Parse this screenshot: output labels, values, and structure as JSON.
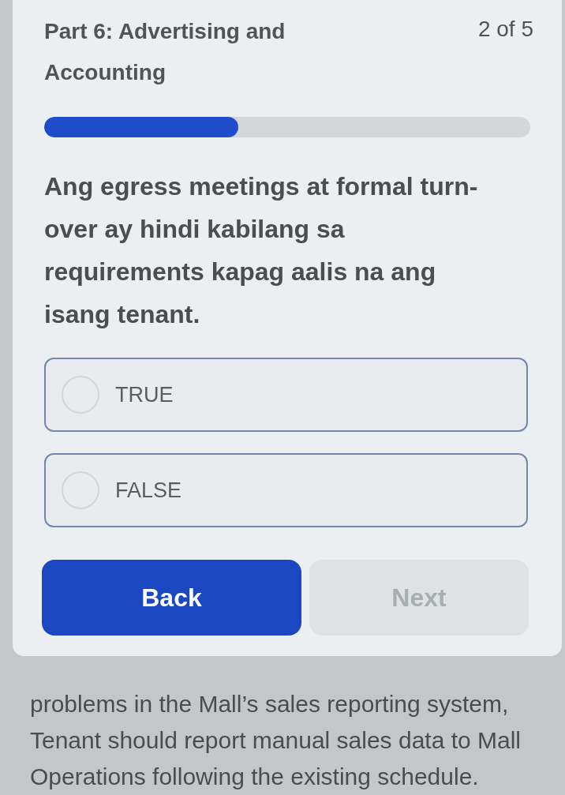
{
  "header": {
    "title": "Part 6: Advertising and Accounting",
    "counter": "2 of 5"
  },
  "progress": {
    "level": 0.4
  },
  "question": "Ang egress meetings at formal turn-over ay hindi kabilang sa requirements kapag aalis na ang isang tenant.",
  "options": [
    {
      "label": "TRUE",
      "selected": false
    },
    {
      "label": "FALSE",
      "selected": false
    }
  ],
  "buttons": [
    {
      "label": "Back",
      "disabled": false
    },
    {
      "label": "Next",
      "disabled": true
    }
  ],
  "background_text": "problems in the Mall’s sales reporting system, Tenant should report manual sales data to Mall Operations following the existing schedule."
}
